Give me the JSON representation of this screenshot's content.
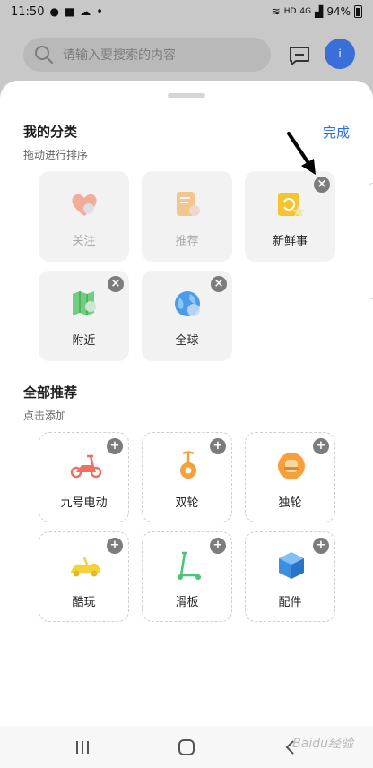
{
  "status_bar": {
    "time": "11:50",
    "dot": "•",
    "network": "HD",
    "signal_label": "4G",
    "battery_percent": "94%"
  },
  "header": {
    "search_placeholder": "请输入要搜索的内容",
    "avatar_initial": "i"
  },
  "my_categories": {
    "title": "我的分类",
    "subtitle": "拖动进行排序",
    "done_label": "完成",
    "items": [
      {
        "label": "关注",
        "icon": "heart-icon",
        "removable": false
      },
      {
        "label": "推荐",
        "icon": "document-icon",
        "removable": false
      },
      {
        "label": "新鲜事",
        "icon": "news-icon",
        "removable": true
      },
      {
        "label": "附近",
        "icon": "map-icon",
        "removable": true
      },
      {
        "label": "全球",
        "icon": "globe-icon",
        "removable": true
      }
    ]
  },
  "all_recommend": {
    "title": "全部推荐",
    "subtitle": "点击添加",
    "items": [
      {
        "label": "九号电动",
        "icon": "scooter-icon"
      },
      {
        "label": "双轮",
        "icon": "balance-scooter-icon"
      },
      {
        "label": "独轮",
        "icon": "unicycle-icon"
      },
      {
        "label": "酷玩",
        "icon": "gokart-icon"
      },
      {
        "label": "滑板",
        "icon": "kick-scooter-icon"
      },
      {
        "label": "配件",
        "icon": "box-icon"
      }
    ]
  },
  "badges": {
    "remove": "×",
    "add": "+"
  },
  "watermark": "Baidu经验",
  "colors": {
    "accent": "#2e6fdb",
    "badge": "#7c7c7c",
    "tile_bg": "#f2f2f2"
  }
}
